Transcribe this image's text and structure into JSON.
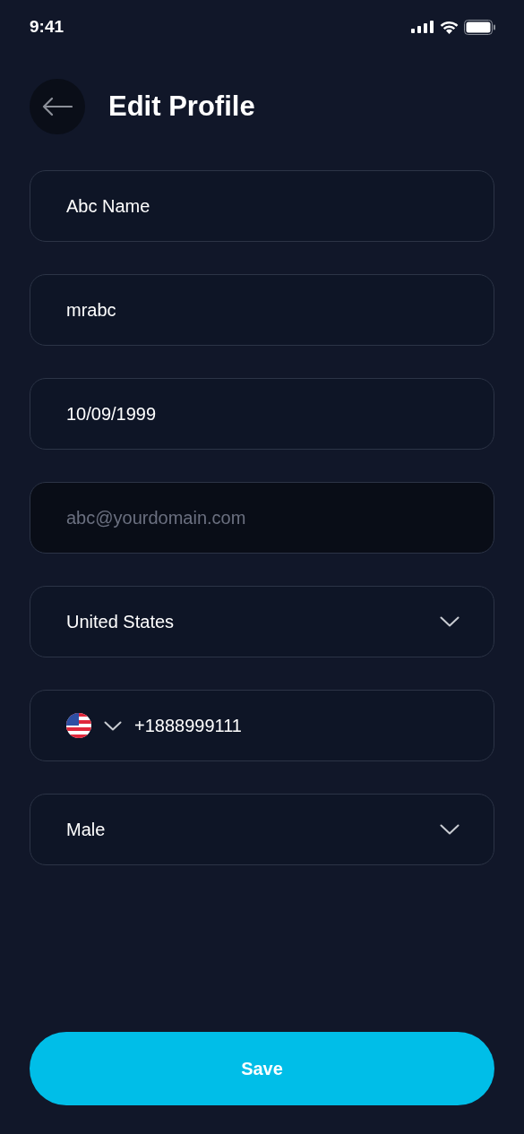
{
  "status_bar": {
    "time": "9:41"
  },
  "header": {
    "title": "Edit Profile"
  },
  "fields": [
    {
      "kind": "text",
      "value": "Abc Name"
    },
    {
      "kind": "text",
      "value": "mrabc"
    },
    {
      "kind": "text",
      "value": "10/09/1999"
    },
    {
      "kind": "text",
      "placeholder": "abc@yourdomain.com"
    },
    {
      "kind": "select",
      "value": "United States"
    },
    {
      "kind": "phone",
      "value": "+1888999111"
    },
    {
      "kind": "select",
      "value": "Male"
    }
  ],
  "save_button": {
    "label": "Save"
  }
}
